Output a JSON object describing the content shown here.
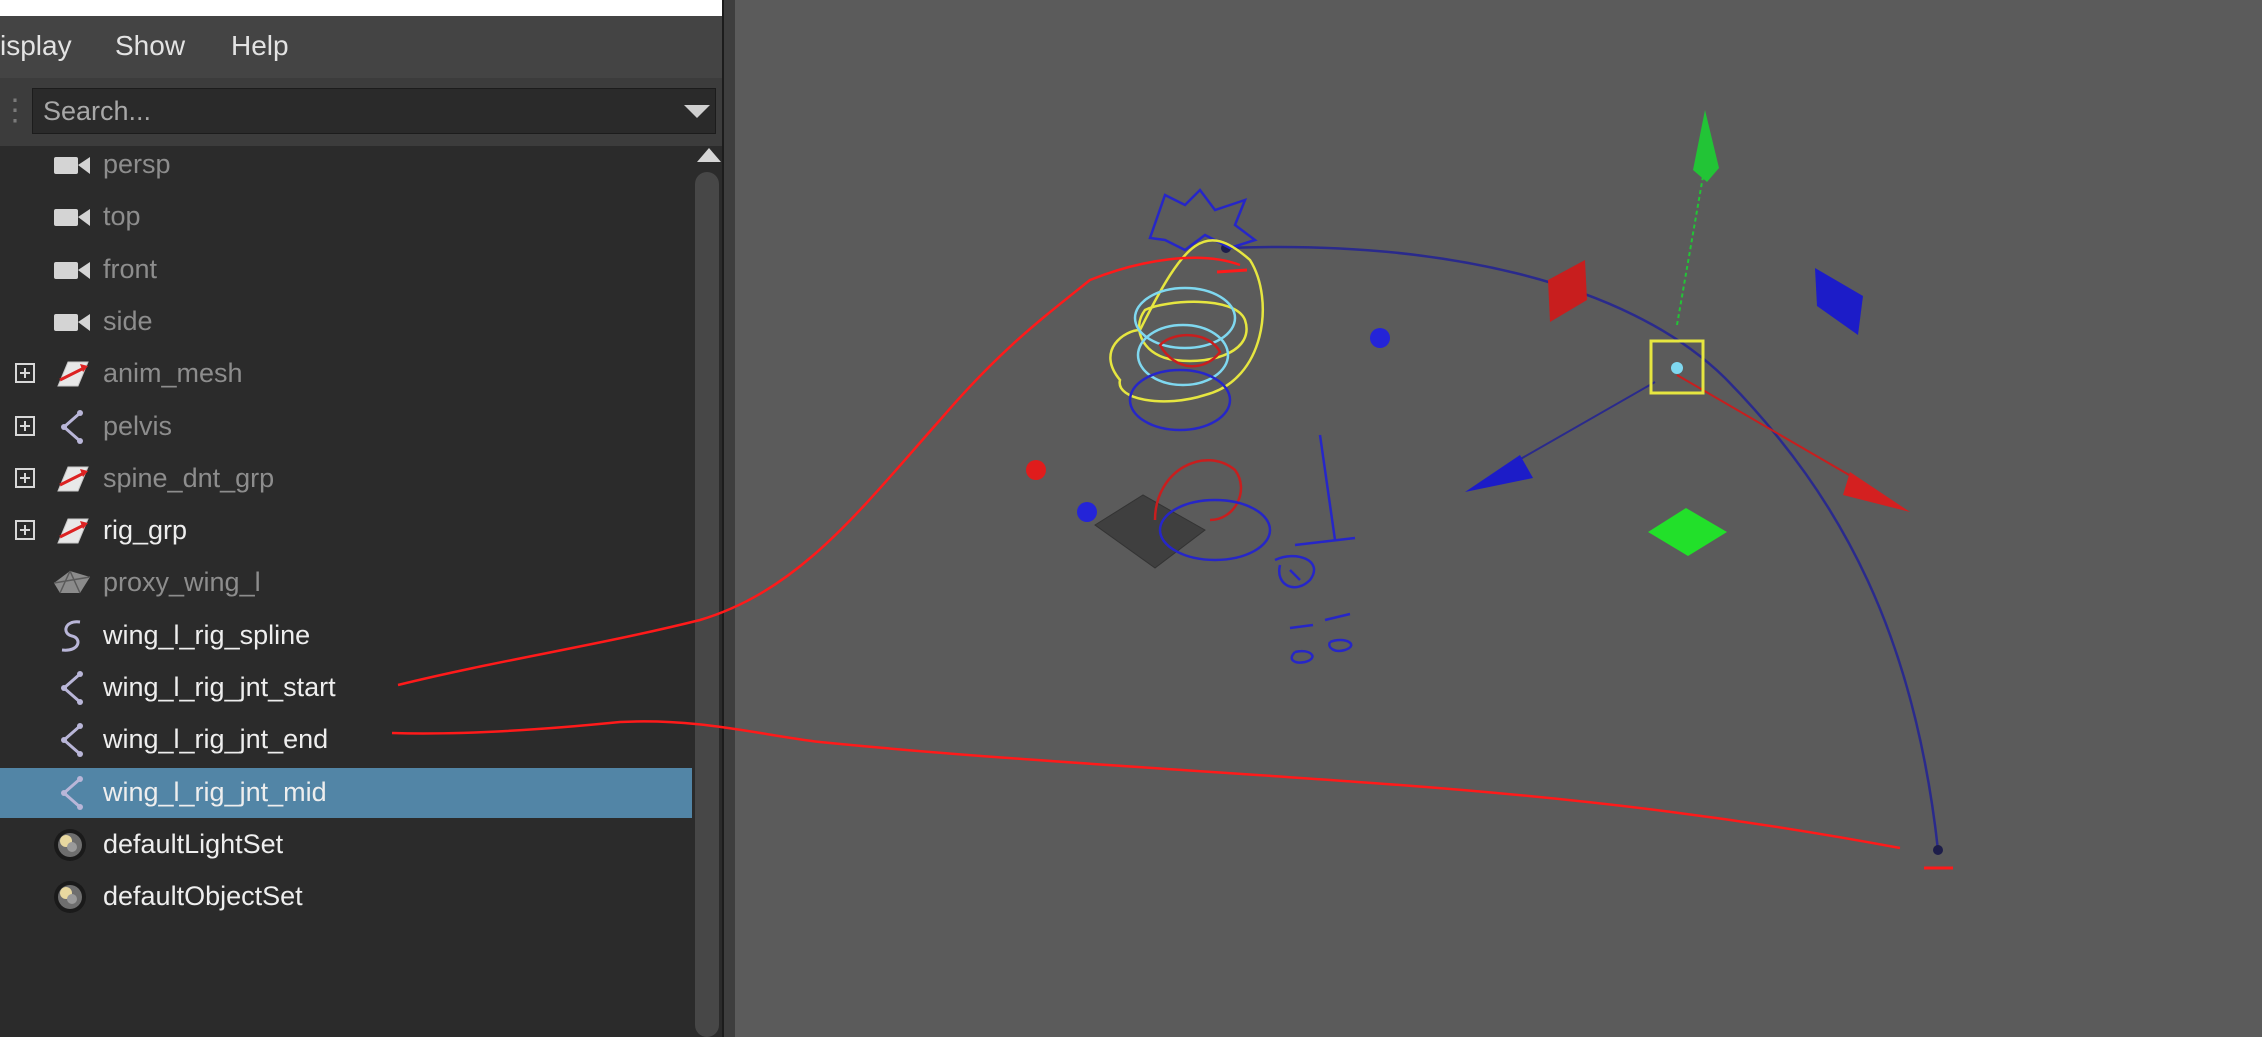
{
  "menubar": {
    "items": [
      "isplay",
      "Show",
      "Help"
    ]
  },
  "search": {
    "placeholder": "Search..."
  },
  "outliner": {
    "items": [
      {
        "label": "persp",
        "icon": "camera-icon",
        "expandable": false,
        "dim": true
      },
      {
        "label": "top",
        "icon": "camera-icon",
        "expandable": false,
        "dim": true
      },
      {
        "label": "front",
        "icon": "camera-icon",
        "expandable": false,
        "dim": true
      },
      {
        "label": "side",
        "icon": "camera-icon",
        "expandable": false,
        "dim": true
      },
      {
        "label": "anim_mesh",
        "icon": "group-icon",
        "expandable": true,
        "dim": true
      },
      {
        "label": "pelvis",
        "icon": "joint-icon",
        "expandable": true,
        "dim": true
      },
      {
        "label": "spine_dnt_grp",
        "icon": "group-icon",
        "expandable": true,
        "dim": true
      },
      {
        "label": "rig_grp",
        "icon": "group-icon",
        "expandable": true,
        "dim": false
      },
      {
        "label": "proxy_wing_l",
        "icon": "mesh-icon",
        "expandable": false,
        "dim": true
      },
      {
        "label": "wing_l_rig_spline",
        "icon": "curve-icon",
        "expandable": false,
        "dim": false
      },
      {
        "label": "wing_l_rig_jnt_start",
        "icon": "joint-icon",
        "expandable": false,
        "dim": false
      },
      {
        "label": "wing_l_rig_jnt_end",
        "icon": "joint-icon",
        "expandable": false,
        "dim": false
      },
      {
        "label": "wing_l_rig_jnt_mid",
        "icon": "joint-icon",
        "expandable": false,
        "dim": false,
        "selected": true
      },
      {
        "label": "defaultLightSet",
        "icon": "set-icon",
        "expandable": false,
        "dim": false
      },
      {
        "label": "defaultObjectSet",
        "icon": "set-icon",
        "expandable": false,
        "dim": false
      }
    ]
  },
  "colors": {
    "panel_bg": "#2b2b2b",
    "viewport_bg": "#5b5b5b",
    "selection": "#5285a6",
    "annotation": "#ff1a1a",
    "curve": "#2a2a8c",
    "gizmo_x": "#d42020",
    "gizmo_y": "#22c436",
    "gizmo_z": "#1c1cc8",
    "highlight": "#e6e640"
  }
}
